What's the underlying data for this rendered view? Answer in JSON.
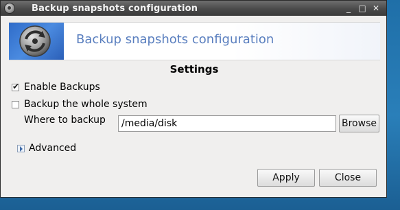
{
  "window": {
    "title": "Backup snapshots configuration",
    "controls": {
      "minimize": "_",
      "maximize": "□",
      "close": "✕"
    }
  },
  "banner": {
    "title": "Backup snapshots configuration",
    "icon": "backup-snapshot-icon"
  },
  "settings": {
    "section_title": "Settings",
    "enable_backups": {
      "label": "Enable Backups",
      "checked": true
    },
    "whole_system": {
      "label": "Backup the whole system",
      "checked": false
    },
    "where_label": "Where to backup",
    "path_value": "/media/disk",
    "browse_label": "Browse",
    "advanced_label": "Advanced"
  },
  "footer": {
    "apply_label": "Apply",
    "close_label": "Close"
  },
  "colors": {
    "desktop_blue": "#1f6fa8",
    "banner_title": "#5a7fbf",
    "titlebar": "#4a4a4a"
  }
}
